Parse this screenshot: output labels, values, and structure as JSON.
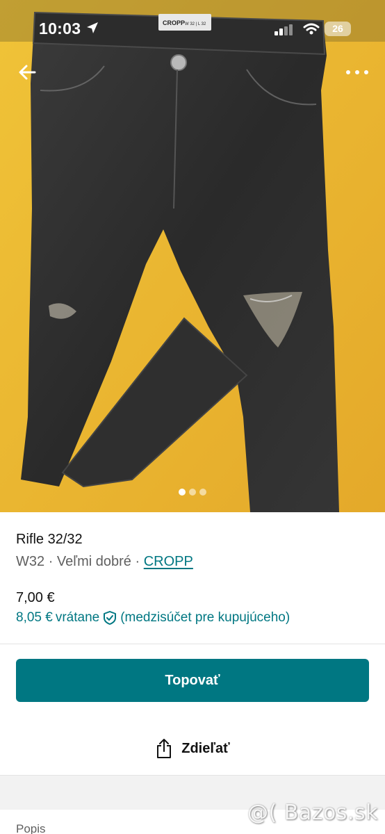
{
  "status_bar": {
    "time": "10:03",
    "battery": "26"
  },
  "listing": {
    "title": "Rifle 32/32",
    "size": "W32",
    "separator": "·",
    "condition": "Veľmi dobré",
    "brand": "CROPP",
    "price": "7,00 €",
    "price_incl": "8,05 €",
    "incl_label": "vrátane",
    "incl_note": "(medzisúčet pre kupujúceho)"
  },
  "actions": {
    "bump_label": "Topovať",
    "share_label": "Zdieľať"
  },
  "gallery": {
    "image_count": 3,
    "active_index": 0,
    "label_brand": "CROPP",
    "label_size": "W 32 | L 32"
  },
  "section": {
    "description_label": "Popis"
  },
  "watermark": "@( Bazos.sk",
  "colors": {
    "accent": "#007782",
    "background_photo": "#e9b52c",
    "denim": "#2d2d2d"
  },
  "icons": {
    "back": "arrow-left-icon",
    "more": "more-horizontal-icon",
    "share": "share-icon",
    "shield": "shield-check-icon",
    "location": "location-arrow-icon"
  }
}
